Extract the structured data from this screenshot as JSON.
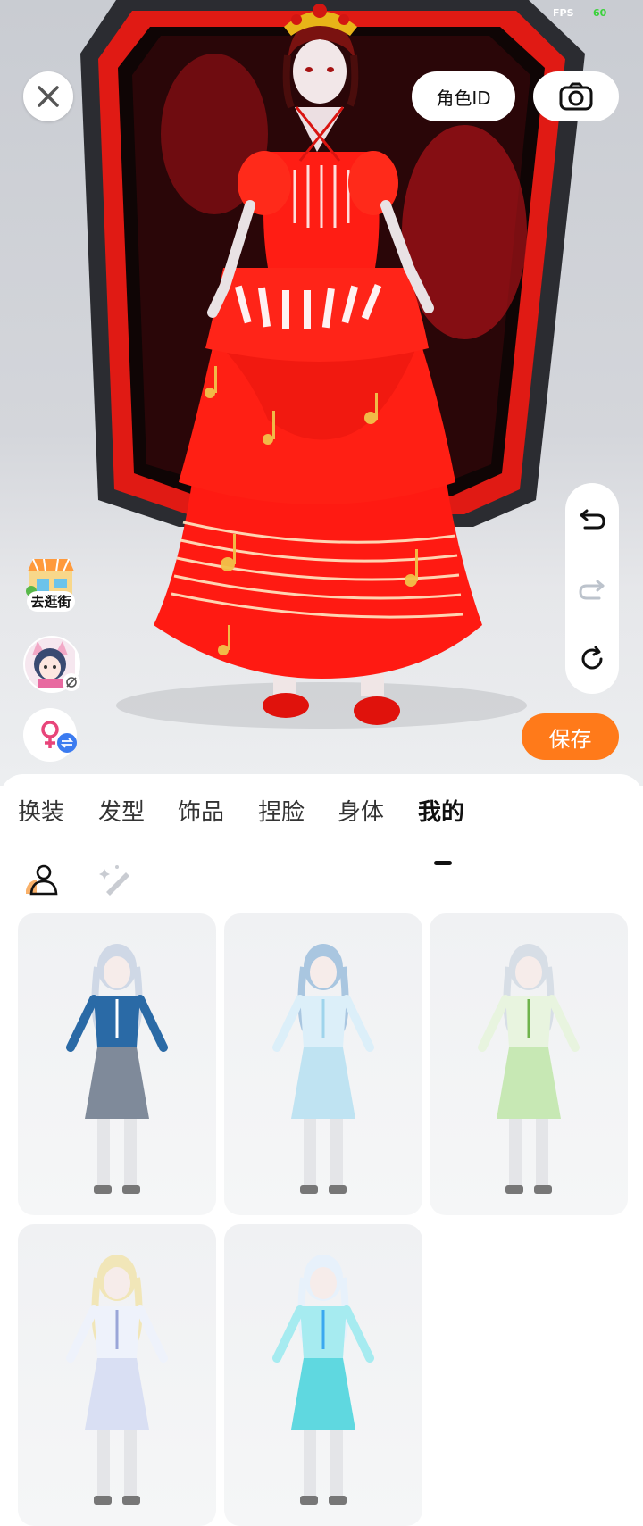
{
  "status": {
    "fps_label": "FPS",
    "fps_value": "60"
  },
  "topbar": {
    "close_icon": "close-icon",
    "role_id_label": "角色ID",
    "camera_icon": "camera-icon"
  },
  "history": {
    "undo_icon": "undo-icon",
    "redo_icon": "redo-icon",
    "reset_icon": "reset-icon"
  },
  "left_actions": {
    "shop_label": "去逛街",
    "avatar_icon": "avatar-icon",
    "gender_icon": "female-icon"
  },
  "save_label": "保存",
  "tabs": [
    {
      "label": "换装"
    },
    {
      "label": "发型"
    },
    {
      "label": "饰品"
    },
    {
      "label": "捏脸"
    },
    {
      "label": "身体"
    },
    {
      "label": "我的",
      "active": true
    }
  ],
  "subtabs": [
    {
      "icon": "person-icon",
      "active": true
    },
    {
      "icon": "magic-wand-icon",
      "active": false
    }
  ],
  "outfits": [
    {
      "name": "outfit-1",
      "hair": "#cfd8e6",
      "top": "#2a6aa6",
      "skirt": "#7f8a9a",
      "accent": "#ffffff"
    },
    {
      "name": "outfit-2",
      "hair": "#a9c6e0",
      "top": "#dceff9",
      "skirt": "#bfe3f2",
      "accent": "#9fd4ec"
    },
    {
      "name": "outfit-3",
      "hair": "#d7dee6",
      "top": "#e8f4df",
      "skirt": "#c7e8b4",
      "accent": "#6fb34c"
    },
    {
      "name": "outfit-4",
      "hair": "#f1e6b8",
      "top": "#eef2fb",
      "skirt": "#d9dff3",
      "accent": "#9aa6d8"
    },
    {
      "name": "outfit-5",
      "hair": "#e7f1fb",
      "top": "#a6ebf0",
      "skirt": "#5fd8e0",
      "accent": "#3aa8f0"
    }
  ],
  "colors": {
    "accent_orange": "#ff7a1a",
    "dress_red": "#ff1a12",
    "swap_blue": "#3b7bf0"
  }
}
